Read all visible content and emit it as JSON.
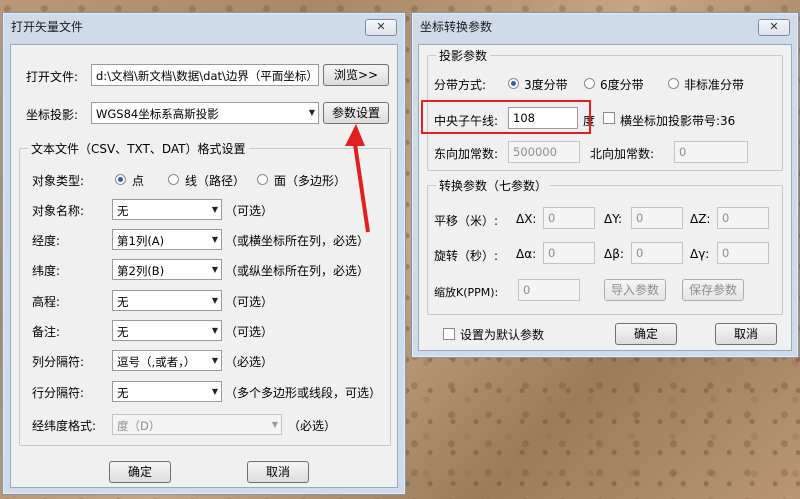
{
  "left_dialog": {
    "title": "打开矢量文件",
    "close": "✕",
    "open_file_label": "打开文件:",
    "open_file_value": "d:\\文档\\新文档\\数据\\dat\\边界（平面坐标）",
    "browse_button": "浏览>>",
    "projection_label": "坐标投影:",
    "projection_value": "WGS84坐标系高斯投影",
    "param_button": "参数设置",
    "group_title": "文本文件（CSV、TXT、DAT）格式设置",
    "object_type_label": "对象类型:",
    "object_types": [
      "点",
      "线（路径）",
      "面（多边形）"
    ],
    "rows": [
      {
        "label": "对象名称:",
        "value": "无",
        "hint": "（可选）"
      },
      {
        "label": "经度:",
        "value": "第1列(A)",
        "hint": "（或横坐标所在列，必选）"
      },
      {
        "label": "纬度:",
        "value": "第2列(B)",
        "hint": "（或纵坐标所在列，必选）"
      },
      {
        "label": "高程:",
        "value": "无",
        "hint": "（可选）"
      },
      {
        "label": "备注:",
        "value": "无",
        "hint": "（可选）"
      },
      {
        "label": "列分隔符:",
        "value": "逗号（,或者，）",
        "hint": "（必选）"
      },
      {
        "label": "行分隔符:",
        "value": "无",
        "hint": "（多个多边形或线段，可选）"
      }
    ],
    "latlon_format_label": "经纬度格式:",
    "latlon_format_value": "度（D）",
    "latlon_format_hint": "（必选）",
    "ok": "确定",
    "cancel": "取消"
  },
  "right_dialog": {
    "title": "坐标转换参数",
    "close": "✕",
    "proj_group": "投影参数",
    "zone_label": "分带方式:",
    "zones": [
      "3度分带",
      "6度分带",
      "非标准分带"
    ],
    "central_meridian_label": "中央子午线:",
    "central_meridian_value": "108",
    "degree_unit": "度",
    "add_zone_label": "横坐标加投影带号:36",
    "east_label": "东向加常数:",
    "east_value": "500000",
    "north_label": "北向加常数:",
    "north_value": "0",
    "seven_group": "转换参数（七参数）",
    "translate_label": "平移（米）:",
    "dx": "ΔX:",
    "dy": "ΔY:",
    "dz": "ΔZ:",
    "rotate_label": "旋转（秒）:",
    "da": "Δα:",
    "db": "Δβ:",
    "dg": "Δγ:",
    "zero": "0",
    "scale_label": "缩放K(PPM):",
    "import_button": "导入参数",
    "save_button": "保存参数",
    "default_label": "设置为默认参数",
    "ok": "确定",
    "cancel": "取消"
  },
  "colors": {
    "annotation_red": "#e02020"
  }
}
